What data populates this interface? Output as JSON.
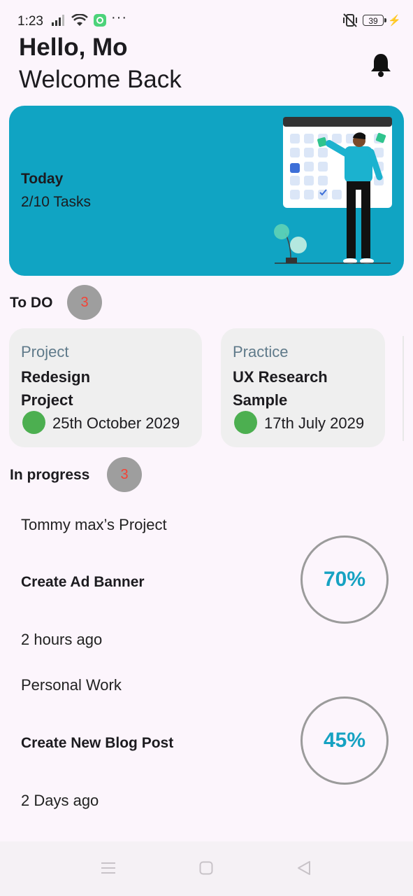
{
  "status_bar": {
    "time": "1:23",
    "battery": "39",
    "more": "···"
  },
  "header": {
    "greeting": "Hello, Mo",
    "subtitle": "Welcome Back"
  },
  "banner": {
    "title": "Today",
    "tasks": "2/10 Tasks",
    "color": "#10a4c3"
  },
  "todo": {
    "label": "To DO",
    "count": "3",
    "cards": [
      {
        "category": "Project",
        "title": "Redesign Project",
        "date": "25th October 2029",
        "dot_color": "#4caf50"
      },
      {
        "category": "Practice",
        "title": "UX Research Sample",
        "date": "17th July 2029",
        "dot_color": "#4caf50"
      }
    ]
  },
  "in_progress": {
    "label": "In progress",
    "count": "3",
    "items": [
      {
        "group": "Tommy max’s Project",
        "task": "Create Ad Banner",
        "time": "2 hours ago",
        "percent": "70%"
      },
      {
        "group": "Personal Work",
        "task": "Create New Blog Post",
        "time": "2 Days ago",
        "percent": "45%"
      }
    ]
  },
  "icons": {
    "bell": "bell-icon",
    "menu": "menu-icon",
    "home": "home-square-icon",
    "back": "back-triangle-icon"
  }
}
